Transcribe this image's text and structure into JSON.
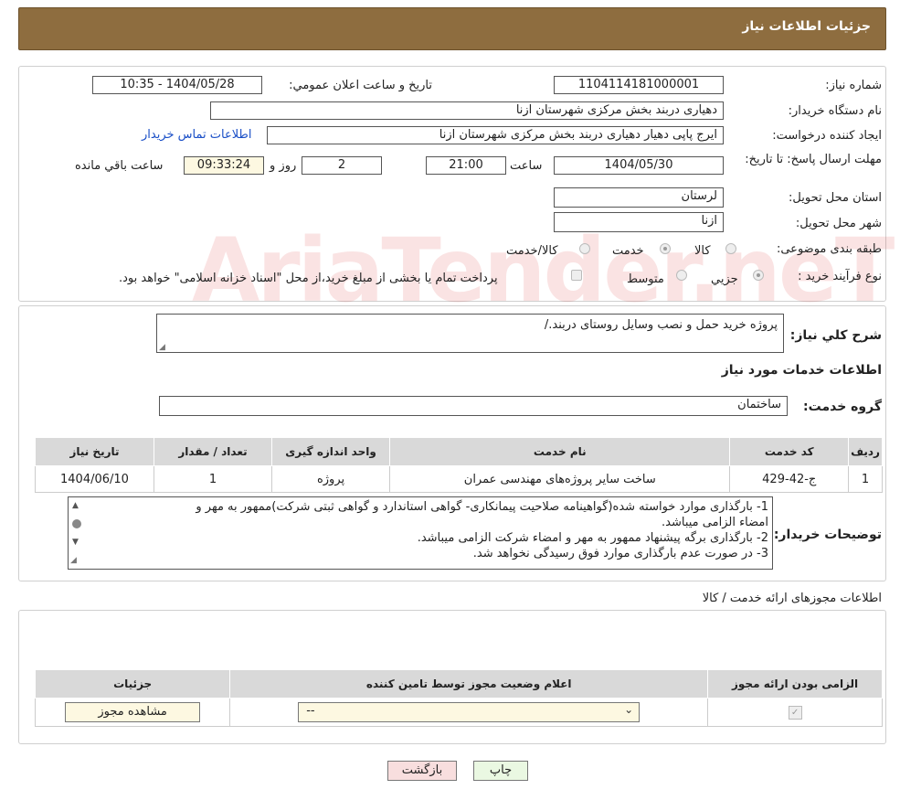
{
  "header": {
    "title": "جزئیات اطلاعات نیاز"
  },
  "fields": {
    "need_number_label": "شماره نیاز:",
    "need_number": "1104114181000001",
    "announce_label": "تاریخ و ساعت اعلان عمومي:",
    "announce_value": "1404/05/28 - 10:35",
    "buyer_org_label": "نام دستگاه خريدار:",
    "buyer_org": "دهیاری دربند بخش مرکزی شهرستان ازنا",
    "creator_label": "ايجاد کننده درخواست:",
    "creator": "ایرج پاپی دهیار دهیاری دربند بخش مرکزی شهرستان ازنا",
    "contact_link": "اطلاعات تماس خريدار",
    "deadline_label": "مهلت ارسال پاسخ: تا تاريخ:",
    "deadline_date": "1404/05/30",
    "time_label": "ساعت",
    "deadline_time": "21:00",
    "days": "2",
    "days_label": "روز و",
    "remaining_time": "09:33:24",
    "remaining_label": "ساعت باقي مانده",
    "province_label": "استان محل تحويل:",
    "province": "لرستان",
    "city_label": "شهر محل تحويل:",
    "city": "ازنا",
    "category_label": "طبقه بندی موضوعی:",
    "category_options": [
      "کالا",
      "خدمت",
      "کالا/خدمت"
    ],
    "category_selected": "خدمت",
    "process_label": "نوع فرآيند خريد :",
    "process_options": [
      "جزيي",
      "متوسط"
    ],
    "process_note": "پرداخت تمام يا بخشی از مبلغ خريد،از محل \"اسناد خزانه اسلامی\" خواهد بود."
  },
  "summary": {
    "label": "شرح کلي نياز:",
    "text": "پروژه خرید حمل و نصب وسایل روستای دربند./"
  },
  "services": {
    "section_title": "اطلاعات خدمات مورد نياز",
    "group_label": "گروه خدمت:",
    "group_value": "ساختمان",
    "headers": [
      "رديف",
      "کد خدمت",
      "نام خدمت",
      "واحد اندازه گيری",
      "تعداد / مقدار",
      "تاريخ نياز"
    ],
    "rows": [
      [
        "1",
        "ج-42-429",
        "ساخت سایر پروژه‌های مهندسی عمران",
        "پروژه",
        "1",
        "1404/06/10"
      ]
    ]
  },
  "buyer_notes": {
    "label": "توضيحات خريدار:",
    "lines": [
      "1- بارگذاری موارد خواسته شده(گواهینامه صلاحیت پیمانکاری-  گواهی استاندارد و گواهی ثبتی شرکت)ممهور به مهر و",
      "امضاء الزامی میباشد.",
      "2- بارگذاری برگه پیشنهاد ممهور به مهر و امضاء شرکت الزامی میباشد.",
      "3- در صورت عدم بارگذاری موارد  فوق رسیدگی نخواهد شد."
    ]
  },
  "permits": {
    "section_title": "اطلاعات مجوزهای ارائه خدمت / کالا",
    "headers": [
      "الزامی بودن ارائه مجوز",
      "اعلام وضعیت مجوز توسط تامین کننده",
      "جزئیات"
    ],
    "select_value": "--",
    "view_button": "مشاهده مجوز"
  },
  "buttons": {
    "print": "چاپ",
    "back": "بازگشت"
  },
  "watermark": "AriaTender.neT",
  "colors": {
    "header_bg": "#8e6d3f",
    "back_button_bg": "#f8dede",
    "print_button_bg": "#eaf8e2",
    "field_yellow": "#fdf8e1"
  }
}
